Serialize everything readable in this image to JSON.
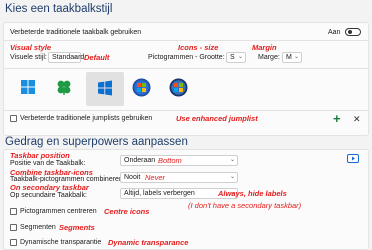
{
  "section1": {
    "title": "Kies een taakbalkstijl",
    "enhanced_label": "Verbeterde traditionele taakbalk gebruiken",
    "enhanced_state": "Aan",
    "notes": {
      "visual_style": "Visual style",
      "icons_size": "Icons - size",
      "margin": "Margin",
      "default": "Default",
      "jumplist": "Use enhanced jumplist"
    },
    "visual_style_label": "Visuele stijl:",
    "visual_style_value": "Standaard",
    "icons_label": "Pictogrammen - Grootte:",
    "icons_value": "S",
    "margin_label": "Marge:",
    "margin_value": "M",
    "jumplist_label": "Verbeterde traditionele jumplists gebruiken",
    "add_symbol": "+",
    "close_symbol": "✕"
  },
  "section2": {
    "title": "Gedrag en superpowers aanpassen",
    "notes": {
      "taskbar_position": "Taskbar position",
      "bottom": "Bottom",
      "combine_icons": "Combine taskbar-icons",
      "never": "Never",
      "secondary": "On secondary taskbar",
      "always_hide": "Always, hide labels",
      "no_secondary": "(I don't have a secondary taskbar)",
      "centre_icons": "Centre icons",
      "segments": "Segments",
      "dynamic_transparance": "Dynamic transparance"
    },
    "position_label": "Positie van de Taakbalk:",
    "position_value": "Onderaan",
    "combine_label": "Taakbalk-pictogrammen combineren:",
    "combine_value": "Nooit",
    "secondary_label": "Op secundaire Taakbalk:",
    "secondary_value": "Altijd, labels verbergen",
    "center_label": "Pictogrammen centreren",
    "segments_label": "Segmenten",
    "transparency_label": "Dynamische transparantie"
  },
  "colors": {
    "accent": "#0067c0",
    "note": "#e41c1c",
    "title": "#1f3e6b"
  }
}
